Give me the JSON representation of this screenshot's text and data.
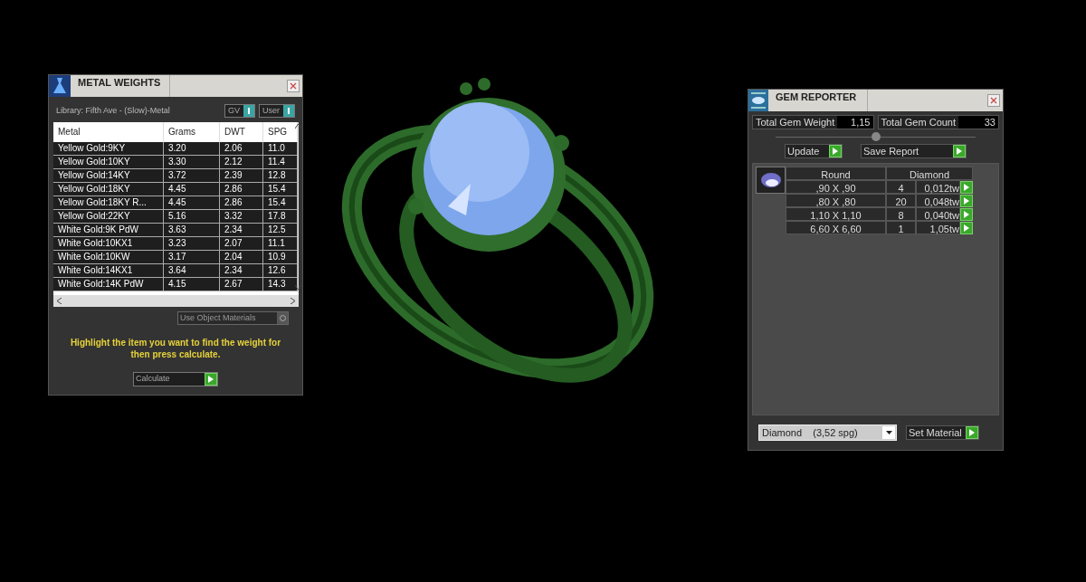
{
  "metal_weights": {
    "title": "METAL WEIGHTS",
    "library": "Library: Fifth Ave - (Slow)-Metal",
    "toggles": [
      {
        "label": "GV",
        "on": true
      },
      {
        "label": "User",
        "on": true
      }
    ],
    "table": {
      "columns": [
        "Metal",
        "Grams",
        "DWT",
        "SPG"
      ],
      "rows": [
        [
          "Yellow Gold:9KY",
          "3.20",
          "2.06",
          "11.0"
        ],
        [
          "Yellow Gold:10KY",
          "3.30",
          "2.12",
          "11.4"
        ],
        [
          "Yellow Gold:14KY",
          "3.72",
          "2.39",
          "12.8"
        ],
        [
          "Yellow Gold:18KY",
          "4.45",
          "2.86",
          "15.4"
        ],
        [
          "Yellow Gold:18KY R...",
          "4.45",
          "2.86",
          "15.4"
        ],
        [
          "Yellow Gold:22KY",
          "5.16",
          "3.32",
          "17.8"
        ],
        [
          "White Gold:9K PdW",
          "3.63",
          "2.34",
          "12.5"
        ],
        [
          "White Gold:10KX1",
          "3.23",
          "2.07",
          "11.1"
        ],
        [
          "White Gold:10KW",
          "3.17",
          "2.04",
          "10.9"
        ],
        [
          "White Gold:14KX1",
          "3.64",
          "2.34",
          "12.6"
        ],
        [
          "White Gold:14K PdW",
          "4.15",
          "2.67",
          "14.3"
        ]
      ]
    },
    "use_object_materials": {
      "label": "Use Object Materials",
      "checked": false
    },
    "hint": "Highlight the item you want to find the weight for then press calculate.",
    "calculate_button": "Calculate"
  },
  "gem_reporter": {
    "title": "GEM REPORTER",
    "total_weight": {
      "label": "Total Gem Weight",
      "value": "1,15"
    },
    "total_count": {
      "label": "Total Gem Count",
      "value": "33"
    },
    "buttons": [
      "Update",
      "Save Report"
    ],
    "table": {
      "columns": [
        "Round",
        "Diamond"
      ],
      "rows": [
        {
          "size": ",90 X ,90",
          "count": "4",
          "weight": "0,012tw"
        },
        {
          "size": ",80 X ,80",
          "count": "20",
          "weight": "0,048tw"
        },
        {
          "size": "1,10 X 1,10",
          "count": "8",
          "weight": "0,040tw"
        },
        {
          "size": "6,60 X 6,60",
          "count": "1",
          "weight": "1,05tw"
        }
      ]
    },
    "material": "Diamond    (3,52 spg)",
    "set_material_button": "Set Material"
  }
}
